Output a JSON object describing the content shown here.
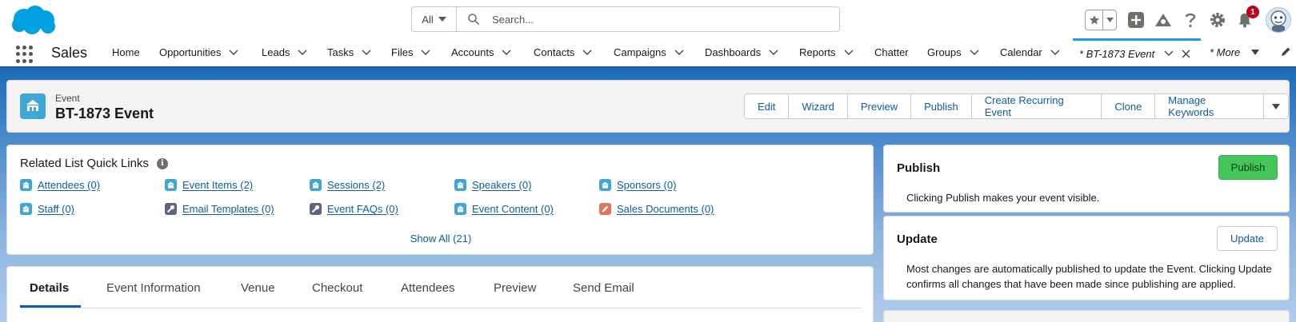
{
  "header": {
    "search_scope": "All",
    "search_placeholder": "Search...",
    "notification_count": "1",
    "colors": {
      "brand": "#00a1e0",
      "accent": "#0b5cab"
    }
  },
  "nav": {
    "app_name": "Sales",
    "items": [
      {
        "label": "Home",
        "dropdown": false
      },
      {
        "label": "Opportunities",
        "dropdown": true
      },
      {
        "label": "Leads",
        "dropdown": true
      },
      {
        "label": "Tasks",
        "dropdown": true
      },
      {
        "label": "Files",
        "dropdown": true
      },
      {
        "label": "Accounts",
        "dropdown": true
      },
      {
        "label": "Contacts",
        "dropdown": true
      },
      {
        "label": "Campaigns",
        "dropdown": true
      },
      {
        "label": "Dashboards",
        "dropdown": true
      },
      {
        "label": "Reports",
        "dropdown": true
      },
      {
        "label": "Chatter",
        "dropdown": false
      },
      {
        "label": "Groups",
        "dropdown": true
      },
      {
        "label": "Calendar",
        "dropdown": true
      }
    ],
    "active_tab": "* BT-1873 Event",
    "more_label": "* More"
  },
  "record": {
    "type_label": "Event",
    "title": "BT-1873 Event",
    "actions": [
      "Edit",
      "Wizard",
      "Preview",
      "Publish",
      "Create Recurring Event",
      "Clone",
      "Manage Keywords"
    ]
  },
  "related_links": {
    "title": "Related List Quick Links",
    "links": [
      {
        "label": "Attendees (0)",
        "icon": "event-icon",
        "color": "#3fa7d6"
      },
      {
        "label": "Event Items (2)",
        "icon": "event-icon",
        "color": "#3fa7d6"
      },
      {
        "label": "Sessions (2)",
        "icon": "event-icon",
        "color": "#3fa7d6"
      },
      {
        "label": "Speakers (0)",
        "icon": "event-icon",
        "color": "#3fa7d6"
      },
      {
        "label": "Sponsors (0)",
        "icon": "event-icon",
        "color": "#3fa7d6"
      },
      {
        "label": "Staff (0)",
        "icon": "event-icon",
        "color": "#3fa7d6"
      },
      {
        "label": "Email Templates (0)",
        "icon": "wrench-icon",
        "color": "#5c6680"
      },
      {
        "label": "Event FAQs (0)",
        "icon": "wrench-icon",
        "color": "#5c6680"
      },
      {
        "label": "Event Content (0)",
        "icon": "event-icon",
        "color": "#3fa7d6"
      },
      {
        "label": "Sales Documents (0)",
        "icon": "pencil-icon",
        "color": "#e3735e"
      }
    ],
    "show_all": "Show All (21)"
  },
  "tabs": [
    "Details",
    "Event Information",
    "Venue",
    "Checkout",
    "Attendees",
    "Preview",
    "Send Email"
  ],
  "publish_panel": {
    "title": "Publish",
    "button": "Publish",
    "text": "Clicking Publish makes your event visible."
  },
  "update_panel": {
    "title": "Update",
    "button": "Update",
    "text_line1": "Most changes are automatically published to update the Event. Clicking Update",
    "text_line2": "confirms all changes that have been made since publishing are applied."
  }
}
